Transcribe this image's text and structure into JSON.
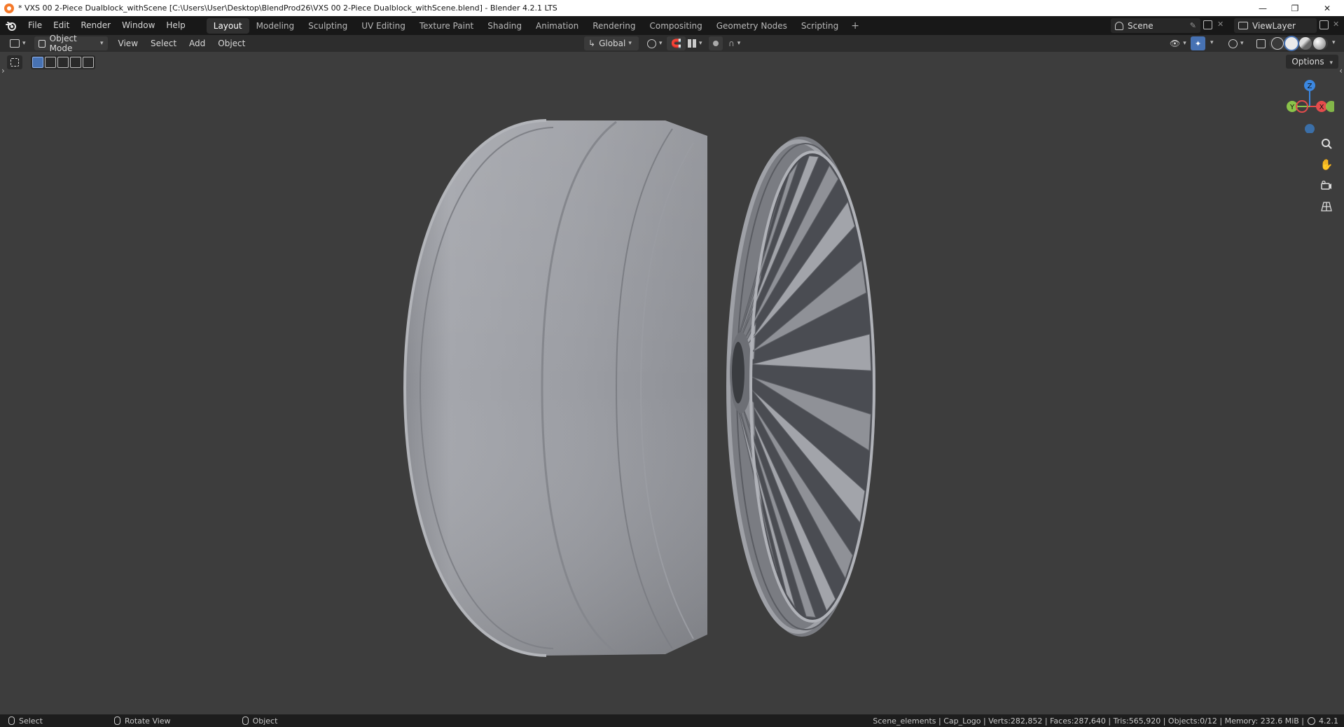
{
  "window": {
    "title": "* VXS 00 2-Piece Dualblock_withScene [C:\\Users\\User\\Desktop\\BlendProd26\\VXS 00 2-Piece Dualblock_withScene.blend] - Blender 4.2.1 LTS",
    "controls": [
      "minimize-icon",
      "restore-icon",
      "close-icon"
    ]
  },
  "menubar": {
    "items": [
      "File",
      "Edit",
      "Render",
      "Window",
      "Help"
    ]
  },
  "workspaces": {
    "tabs": [
      "Layout",
      "Modeling",
      "Sculpting",
      "UV Editing",
      "Texture Paint",
      "Shading",
      "Animation",
      "Rendering",
      "Compositing",
      "Geometry Nodes",
      "Scripting"
    ],
    "active": "Layout",
    "add_label": "+"
  },
  "scene": {
    "name": "Scene"
  },
  "view_layer": {
    "name": "ViewLayer"
  },
  "header": {
    "mode": "Object Mode",
    "menus": [
      "View",
      "Select",
      "Add",
      "Object"
    ],
    "transform_orientation": "Global"
  },
  "viewport": {
    "options_label": "Options",
    "gizmo_axes": [
      "Z",
      "Y",
      "X"
    ],
    "nav_icons": [
      "zoom-icon",
      "pan-hand-icon",
      "camera-icon",
      "grid-perspective-icon"
    ]
  },
  "statusbar": {
    "left": [
      "Select",
      "Rotate View",
      "Object"
    ],
    "stats": "Scene_elements | Cap_Logo | Verts:282,852 | Faces:287,640 | Tris:565,920 | Objects:0/12 | Memory: 232.6 MiB | ",
    "version": "4.2.1"
  },
  "colors": {
    "accent": "#4772b3",
    "viewport_bg": "#3d3d3d",
    "axis_x": "#e44c4c",
    "axis_y": "#8bc34a",
    "axis_z": "#3b87e0"
  }
}
